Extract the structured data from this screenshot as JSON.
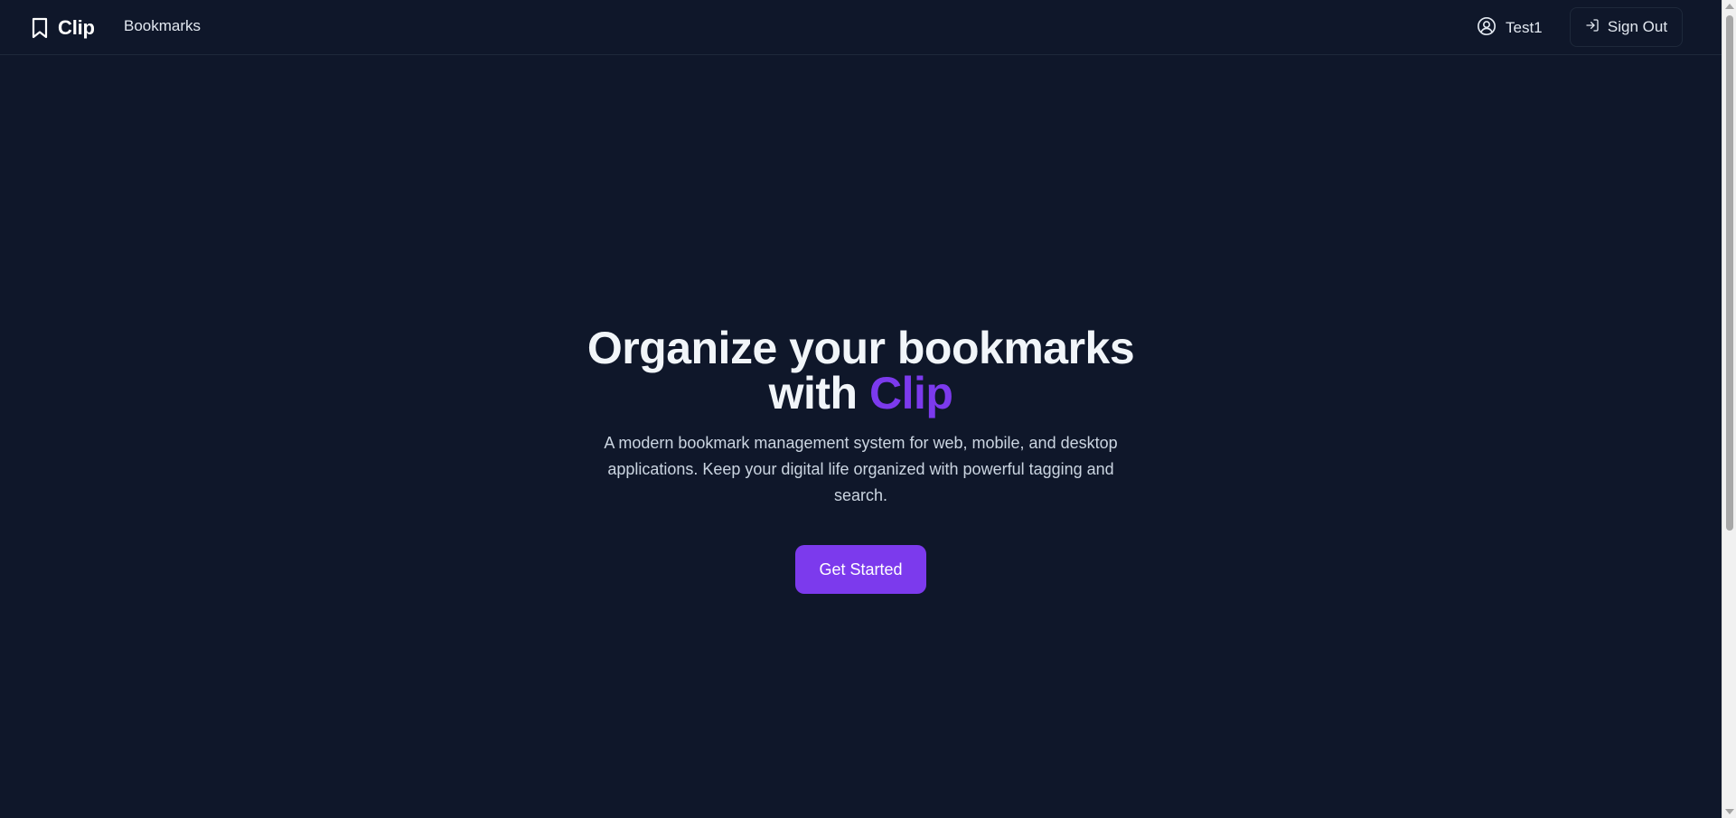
{
  "navbar": {
    "brand": "Clip",
    "links": [
      {
        "label": "Bookmarks"
      }
    ],
    "user_name": "Test1",
    "sign_out_label": "Sign Out"
  },
  "hero": {
    "title_main": "Organize your bookmarks",
    "title_with": "with",
    "title_accent": "Clip",
    "description": "A modern bookmark management system for web, mobile, and desktop applications. Keep your digital life organized with powerful tagging and search.",
    "cta_label": "Get Started"
  },
  "icons": {
    "brand": "bookmark-icon",
    "user": "user-circle-icon",
    "sign_out": "log-in-arrow-icon"
  },
  "colors": {
    "background": "#0f172a",
    "accent": "#7c3aed",
    "text": "#e2e8f0"
  }
}
